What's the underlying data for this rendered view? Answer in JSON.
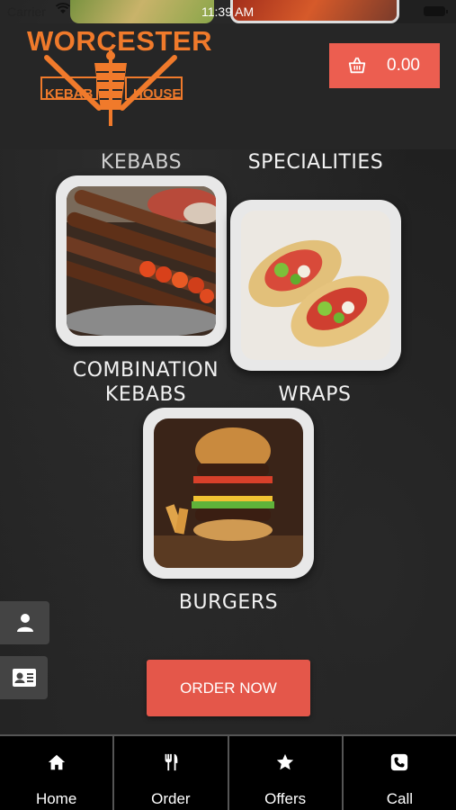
{
  "status_bar": {
    "carrier": "Carrier",
    "time": "11:39 AM"
  },
  "header": {
    "logo": {
      "title": "WORCESTER",
      "word_left": "KEBAB",
      "word_right": "HOUSE",
      "color": "#f07a2b"
    },
    "cart": {
      "amount": "0.00",
      "color": "#ec5e50",
      "icon": "basket-icon"
    }
  },
  "categories": [
    {
      "label": "KEBABS",
      "image": "kebab-skewers-photo"
    },
    {
      "label": "SPECIALITIES"
    },
    {
      "label": "COMBINATION KEBABS"
    },
    {
      "label": "WRAPS",
      "image": "wraps-photo"
    },
    {
      "label": "BURGERS",
      "image": "burger-photo"
    }
  ],
  "side_buttons": [
    {
      "icon": "user-icon"
    },
    {
      "icon": "contact-card-icon"
    }
  ],
  "order_now": {
    "label": "ORDER NOW",
    "color": "#e4574a"
  },
  "bottom_nav": [
    {
      "label": "Home",
      "icon": "home-icon"
    },
    {
      "label": "Order",
      "icon": "fork-knife-icon"
    },
    {
      "label": "Offers",
      "icon": "star-icon"
    },
    {
      "label": "Call",
      "icon": "phone-icon"
    }
  ]
}
